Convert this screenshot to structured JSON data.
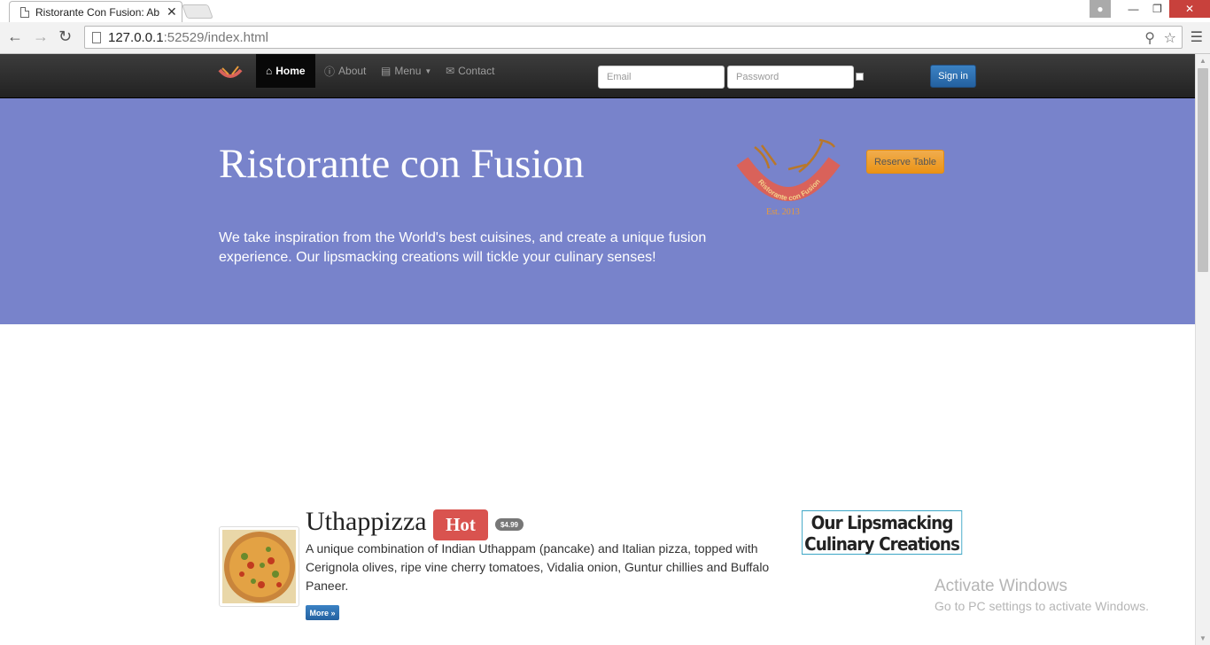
{
  "browser": {
    "tab_title": "Ristorante Con Fusion: Ab",
    "tab_close": "✕",
    "url_host": "127.0.0.1",
    "url_rest": ":52529/index.html"
  },
  "navbar": {
    "items": [
      {
        "label": "Home",
        "icon": "home-icon",
        "active": true
      },
      {
        "label": "About",
        "icon": "info-icon"
      },
      {
        "label": "Menu",
        "icon": "list-icon"
      },
      {
        "label": "Contact",
        "icon": "envelope-icon"
      }
    ],
    "email_placeholder": "Email",
    "password_placeholder": "Password",
    "signin_label": "Sign in"
  },
  "jumbotron": {
    "title": "Ristorante con Fusion",
    "tagline": "We take inspiration from the World's best cuisines, and create a unique fusion experience. Our lipsmacking creations will tickle your culinary senses!",
    "logo_text": "Ristorante con Fusion",
    "logo_est": "Est. 2013",
    "reserve_label": "Reserve Table"
  },
  "featured": {
    "name": "Uthappizza",
    "badge": "Hot",
    "price": "$4.99",
    "description": "A unique combination of Indian Uthappam (pancake) and Italian pizza, topped with Cerignola olives, ripe vine cherry tomatoes, Vidalia onion, Guntur chillies and Buffalo Paneer.",
    "more_label": "More »"
  },
  "sidebar": {
    "heading": "Our Lipsmacking Culinary Creations"
  },
  "watermark": {
    "title": "Activate Windows",
    "subtitle": "Go to PC settings to activate Windows."
  },
  "colors": {
    "jumbotron": "#7883cb",
    "navbar": "#222222",
    "reserve_button": "#f0ad4e",
    "hot_badge": "#d9534f",
    "primary_button": "#2a6fb2"
  }
}
